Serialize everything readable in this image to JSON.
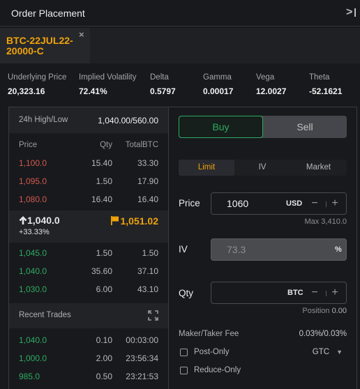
{
  "header": {
    "title": "Order Placement",
    "collapse_icon": "collapse-right-icon"
  },
  "tabs": [
    {
      "label": "BTC-22JUL22-20000-C",
      "close_icon": "close-icon",
      "close_glyph": "×"
    }
  ],
  "greeks": [
    {
      "label": "Underlying Price",
      "value": "20,323.16"
    },
    {
      "label": "Implied Volatility",
      "value": "72.41%"
    },
    {
      "label": "Delta",
      "value": "0.5797"
    },
    {
      "label": "Gamma",
      "value": "0.00017"
    },
    {
      "label": "Vega",
      "value": "12.0027"
    },
    {
      "label": "Theta",
      "value": "-52.1621"
    }
  ],
  "orderbook": {
    "high_low_label": "24h High/Low",
    "high_low_value": "1,040.00/560.00",
    "columns": [
      "Price",
      "Qty",
      "TotalBTC"
    ],
    "asks": [
      {
        "price": "1,100.0",
        "qty": "15.40",
        "total": "33.30"
      },
      {
        "price": "1,095.0",
        "qty": "1.50",
        "total": "17.90"
      },
      {
        "price": "1,080.0",
        "qty": "16.40",
        "total": "16.40"
      }
    ],
    "last_price": "1,040.0",
    "last_direction_icon": "arrow-up-icon",
    "change": "+33.33%",
    "mark_icon": "flag-icon",
    "mark_price": "1,051.02",
    "bids": [
      {
        "price": "1,045.0",
        "qty": "1.50",
        "total": "1.50"
      },
      {
        "price": "1,040.0",
        "qty": "35.60",
        "total": "37.10"
      },
      {
        "price": "1,030.0",
        "qty": "6.00",
        "total": "43.10"
      }
    ],
    "colors": {
      "ask": "#d05a4c",
      "bid": "#2cac61",
      "mark": "#f0a30a"
    }
  },
  "recent_trades": {
    "title": "Recent Trades",
    "expand_icon": "expand-icon",
    "rows": [
      {
        "price": "1,040.0",
        "qty": "0.10",
        "time": "00:03:00"
      },
      {
        "price": "1,000.0",
        "qty": "2.00",
        "time": "23:56:34"
      },
      {
        "price": "985.0",
        "qty": "0.50",
        "time": "23:21:53"
      }
    ]
  },
  "order_form": {
    "buy_label": "Buy",
    "sell_label": "Sell",
    "selected_side": "Buy",
    "order_types": [
      "Limit",
      "IV",
      "Market"
    ],
    "selected_type": "Limit",
    "price": {
      "label": "Price",
      "value": "1060",
      "unit": "USD",
      "hint_label": "Max",
      "hint_value": "3,410.0"
    },
    "iv": {
      "label": "IV",
      "value": "73.3",
      "unit": "%"
    },
    "qty": {
      "label": "Qty",
      "value": "",
      "unit": "BTC",
      "hint_label": "Position",
      "hint_value": "0.00"
    },
    "stepper_minus": "−",
    "stepper_plus": "+",
    "fee_label": "Maker/Taker Fee",
    "fee_value": "0.03%/0.03%",
    "post_only": {
      "label": "Post-Only",
      "checked": false
    },
    "reduce_only": {
      "label": "Reduce-Only",
      "checked": false
    },
    "time_in_force": "GTC",
    "tif_caret": "▼"
  },
  "theme": {
    "accent": "#f0a30a",
    "buy": "#2cac61",
    "sell": "#d05a4c",
    "background": "#18191d"
  }
}
